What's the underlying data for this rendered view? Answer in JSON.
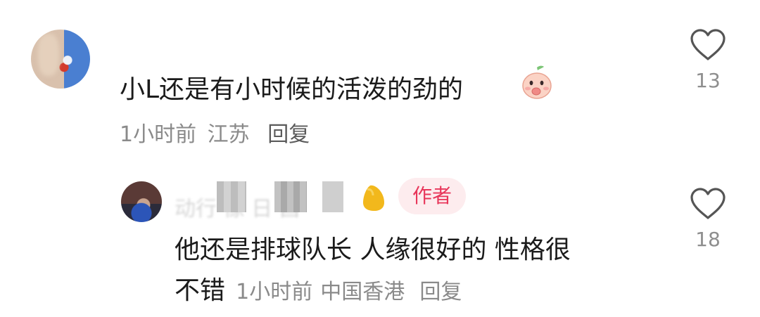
{
  "comment": {
    "text": "小L还是有小时候的活泼的劲的",
    "emoji": "peach-face-emoji",
    "time": "1小时前",
    "location": "江苏",
    "reply_label": "回复",
    "likes": "13"
  },
  "reply": {
    "username_blurred": "动行 像 日 昌",
    "author_tag": "作者",
    "text_line1": "他还是排球队长 人缘很好的 性格很",
    "text_line2": "不错",
    "time": "1小时前",
    "location": "中国香港",
    "reply_label": "回复",
    "likes": "18"
  },
  "colors": {
    "author_tag_bg": "#fdecee",
    "author_tag_text": "#e8365a",
    "meta_text": "#8a8a8a"
  }
}
